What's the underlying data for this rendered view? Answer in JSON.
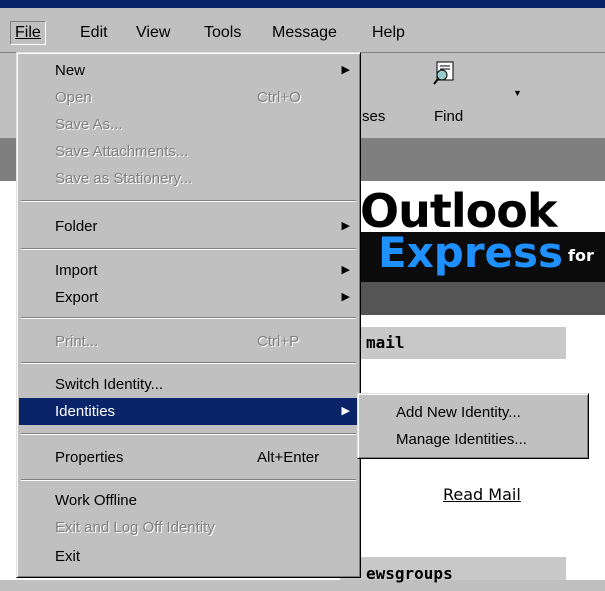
{
  "menubar": {
    "items": [
      {
        "label": "File",
        "mnemonic": "F"
      },
      {
        "label": "Edit",
        "mnemonic": "E"
      },
      {
        "label": "View",
        "mnemonic": "V"
      },
      {
        "label": "Tools",
        "mnemonic": "T"
      },
      {
        "label": "Message",
        "mnemonic": "M"
      },
      {
        "label": "Help",
        "mnemonic": "H"
      }
    ]
  },
  "toolbar": {
    "addresses_fragment": "ses",
    "find_label": "Find"
  },
  "file_menu": {
    "items": [
      {
        "label": "New",
        "enabled": true,
        "submenu": true
      },
      {
        "label": "Open",
        "shortcut": "Ctrl+O",
        "enabled": false
      },
      {
        "label": "Save As...",
        "enabled": false
      },
      {
        "label": "Save Attachments...",
        "enabled": false
      },
      {
        "label": "Save as Stationery...",
        "enabled": false
      },
      {
        "label": "Folder",
        "enabled": true,
        "submenu": true
      },
      {
        "label": "Import",
        "enabled": true,
        "submenu": true
      },
      {
        "label": "Export",
        "enabled": true,
        "submenu": true
      },
      {
        "label": "Print...",
        "shortcut": "Ctrl+P",
        "enabled": false
      },
      {
        "label": "Switch Identity...",
        "enabled": true
      },
      {
        "label": "Identities",
        "enabled": true,
        "submenu": true,
        "selected": true
      },
      {
        "label": "Properties",
        "shortcut": "Alt+Enter",
        "enabled": true
      },
      {
        "label": "Work Offline",
        "enabled": true
      },
      {
        "label": "Exit and Log Off Identity",
        "enabled": false
      },
      {
        "label": "Exit",
        "enabled": true
      }
    ]
  },
  "identities_submenu": {
    "items": [
      {
        "label": "Add New Identity..."
      },
      {
        "label": "Manage Identities..."
      }
    ]
  },
  "content": {
    "logo_top": "Outlook",
    "logo_bottom": "Express",
    "logo_for": "for",
    "mail_heading": "mail",
    "read_mail_link": "Read Mail",
    "newsgroups_heading": "ewsgroups"
  },
  "colors": {
    "menu_bg": "#c0c0c0",
    "selection": "#0a246a",
    "express_blue": "#1e90ff"
  }
}
